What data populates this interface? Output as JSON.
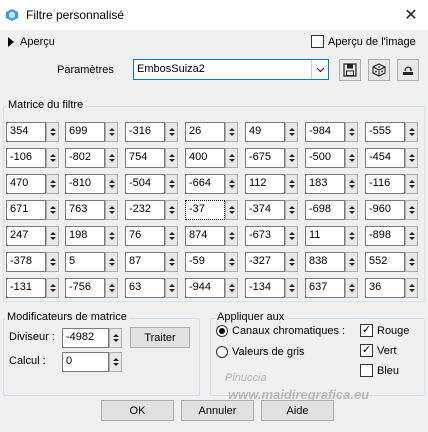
{
  "window": {
    "title": "Filtre personnalisé"
  },
  "preview": {
    "toggle_label": "Aperçu",
    "image_preview_label": "Aperçu de l'image",
    "image_preview_checked": false
  },
  "params": {
    "label": "Paramètres",
    "value": "EmbosSuiza2"
  },
  "matrix": {
    "label": "Matrice du filtre",
    "rows": [
      [
        "354",
        "699",
        "-316",
        "26",
        "49",
        "-984",
        "-555"
      ],
      [
        "-106",
        "-802",
        "754",
        "400",
        "-675",
        "-500",
        "-454"
      ],
      [
        "470",
        "-810",
        "-504",
        "-664",
        "112",
        "183",
        "-116"
      ],
      [
        "671",
        "763",
        "-232",
        "-37",
        "-374",
        "-698",
        "-960"
      ],
      [
        "247",
        "198",
        "76",
        "874",
        "-673",
        "11",
        "-898"
      ],
      [
        "-378",
        "5",
        "87",
        "-59",
        "-327",
        "838",
        "552"
      ],
      [
        "-131",
        "-756",
        "63",
        "-944",
        "-134",
        "637",
        "36"
      ]
    ]
  },
  "modifiers": {
    "label": "Modificateurs de matrice",
    "divisor_label": "Diviseur :",
    "divisor_value": "-4982",
    "calc_label": "Calcul :",
    "calc_value": "0",
    "process_button": "Traiter"
  },
  "apply": {
    "label": "Appliquer aux",
    "channels_label": "Canaux chromatiques :",
    "gray_label": "Valeurs de gris",
    "selected": "channels",
    "red_label": "Rouge",
    "red_checked": true,
    "green_label": "Vert",
    "green_checked": true,
    "blue_label": "Bleu",
    "blue_checked": false
  },
  "buttons": {
    "ok": "OK",
    "cancel": "Annuler",
    "help": "Aide"
  },
  "watermark": {
    "line1": "Pinuccia",
    "line2": "www.maidiregrafica.eu"
  }
}
